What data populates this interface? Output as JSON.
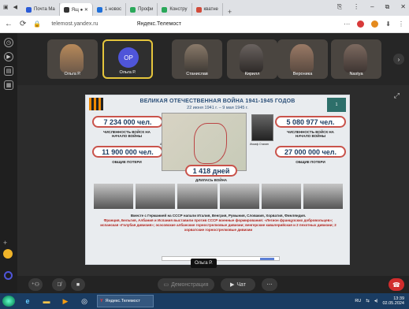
{
  "browser": {
    "tabs": [
      {
        "label": "Почта Ma",
        "color": "#2a5bd7"
      },
      {
        "label": "Ящ ● ✕",
        "color": "#333333"
      },
      {
        "label": "1 новос",
        "color": "#1e6fd9"
      },
      {
        "label": "Профи",
        "color": "#2aa85a"
      },
      {
        "label": "Констру",
        "color": "#2aa85a"
      },
      {
        "label": "кватнe",
        "color": "#d14b3a"
      }
    ],
    "new_tab": "+",
    "window_controls": [
      "⎘",
      "⋮",
      "–",
      "⧉",
      "✕"
    ],
    "nav": [
      "←",
      "⟳"
    ],
    "url": "telemost.yandex.ru",
    "page_title": "Яндекс.Телемост",
    "addr_right": [
      "⋯",
      "⬇",
      "⋮"
    ]
  },
  "participants": [
    {
      "name": "Ольга Р.",
      "type": "video"
    },
    {
      "name": "Ольга Р.",
      "type": "avatar",
      "initials": "OP",
      "selected": true
    },
    {
      "name": "Станислав",
      "type": "video"
    },
    {
      "name": "Кирилл",
      "type": "video"
    },
    {
      "name": "Вероника",
      "type": "video"
    },
    {
      "name": "Nastya",
      "type": "video"
    }
  ],
  "slide": {
    "title": "ВЕЛИКАЯ ОТЕЧЕСТВЕННАЯ ВОЙНА 1941-1945 ГОДОВ",
    "subtitle": "22 июня 1941 г. – 9 мая 1945 г.",
    "badge": "1",
    "stats": [
      {
        "value": "7 234 000 чел.",
        "caption": "ЧИСЛЕННОСТЬ ВОЙСК НА НАЧАЛО ВОЙНЫ"
      },
      {
        "value": "11 900 000 чел.",
        "caption": "ОБЩИЕ ПОТЕРИ"
      },
      {
        "value": "5 080 977 чел.",
        "caption": "ЧИСЛЕННОСТЬ ВОЙСК НА НАЧАЛО ВОЙНЫ"
      },
      {
        "value": "27 000 000 чел.",
        "caption": "ОБЩИЕ ПОТЕРИ"
      },
      {
        "value": "1 418 дней",
        "caption": "ДЛИЛАСЬ ВОЙНА"
      }
    ],
    "portrait_left_label": "Адольф Гитлер",
    "portrait_right_label": "Иосиф Сталин",
    "text_intro": "Вместе с Германией на СССР напали Италия, Венгрия, Румыния, Словакия, Хорватия, Финляндия.",
    "text_body": "Франция, Бельгия, Албания и Испания выставили против СССР военные формирования: «Легион французских добровольцев»; испанская «Голубая дивизия»; эсэсовские албанские горнострелковые дивизии; венгерские кавалерийская и 2 пехотных дивизии; 2 хорватские горнострелковые дивизии"
  },
  "speaker_label": "Ольга Р.",
  "controls": {
    "demo": "Демонстрация",
    "chat": "Чат",
    "more": "⋯"
  },
  "taskbar": {
    "active_task": "Яндекс.Телемост",
    "lang": "RU",
    "time": "13:39",
    "date": "02.05.2024"
  }
}
